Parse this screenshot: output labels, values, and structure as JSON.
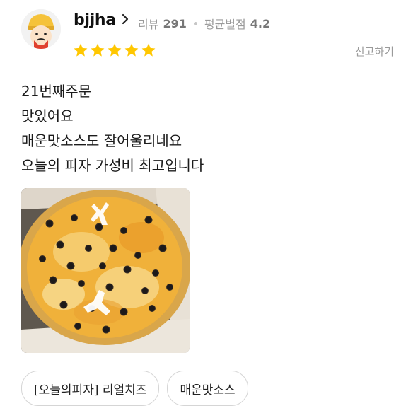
{
  "reviewer": {
    "username": "bjjha",
    "review_label": "리뷰",
    "review_count": "291",
    "avg_label": "평균별점",
    "avg_score": "4.2",
    "rating": 5
  },
  "actions": {
    "report_label": "신고하기"
  },
  "review": {
    "lines": [
      "21번째주문",
      "맛있어요",
      "매운맛소스도 잘어울리네요",
      "오늘의 피자 가성비 최고입니다"
    ]
  },
  "tags": [
    "[오늘의피자] 리얼치즈",
    "매운맛소스"
  ],
  "colors": {
    "star": "#ffc700",
    "muted_text": "#9a9a9a",
    "tag_border": "#d5d5d5"
  },
  "icons": [
    "avatar-character-icon",
    "chevron-right-icon",
    "star-icon",
    "pizza-photo"
  ]
}
